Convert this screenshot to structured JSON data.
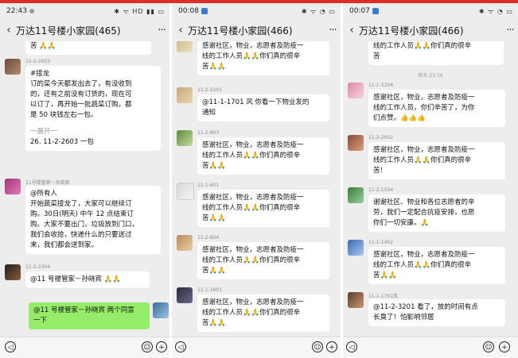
{
  "panels": [
    {
      "status_time": "22:43",
      "status_icons": "✱ ᯤ HD ▮▮ ▭",
      "title": "万达11号楼小家园(465)",
      "bell": "🔕",
      "more": "···",
      "messages": [
        {
          "sender": "",
          "lines": [
            "苦 🙏🙏"
          ]
        },
        {
          "sender": "11-2-2603",
          "lines": [
            "#接龙",
            "订的菜今天都发出去了，有没收到",
            "的，还有之前没有订货的，现在可",
            "以订了，再开始一批蔬菜订购，都",
            "是 50 块钱左右一包。",
            "",
            "一展开一",
            "26. 11-2-2603 一包"
          ]
        },
        {
          "sender": "11号楼管家－孙晓宾",
          "lines": [
            "@所有人",
            "开始蔬菜接龙了，大家可以继续订",
            "购。30日(明天) 中午 12 点结束订",
            "购。大家不要出门，垃圾放到门口，",
            "我们会收拾，快递什么的只要送过",
            "来，我们都会送到家。"
          ]
        },
        {
          "sender": "11-2-2304",
          "lines": [
            "@11 号楼管家－孙晓宾 🙏🙏"
          ]
        },
        {
          "sender": "",
          "lines": [
            "@11 号楼管家－孙晓宾  两个同意",
            "一下"
          ]
        }
      ]
    },
    {
      "status_time": "00:08",
      "status_icons": "✱ ᯤ ◔ ▭",
      "title": "万达11号楼小家园(466)",
      "bell": "🔕",
      "more": "···",
      "messages": [
        {
          "sender": "",
          "lines": [
            "感谢社区，物业，志愿者及防疫一",
            "线的工作人员🙏🙏你们真的很辛",
            "苦🙏🙏"
          ]
        },
        {
          "sender": "11-2-3201",
          "lines": [
            "@11-1-1701 风  你看一下物业发的",
            "通知"
          ]
        },
        {
          "sender": "11-2-803",
          "lines": [
            "感谢社区，物业，志愿者及防疫一",
            "线的工作人员🙏🙏你们真的很辛",
            "苦🙏🙏"
          ]
        },
        {
          "sender": "11-1-601",
          "lines": [
            "感谢社区，物业，志愿者及防疫一",
            "线的工作人员🙏🙏你们真的很辛",
            "苦🙏🙏"
          ]
        },
        {
          "sender": "11-2-804",
          "lines": [
            "感谢社区，物业，志愿者及防疫一",
            "线的工作人员🙏🙏你们真的很辛",
            "苦🙏🙏"
          ]
        },
        {
          "sender": "11-1-1601",
          "lines": [
            "感谢社区，物业，志愿者及防疫一",
            "线的工作人员🙏🙏你们真的很辛",
            "苦🙏🙏"
          ]
        }
      ]
    },
    {
      "status_time": "00:07",
      "status_icons": "✱ ᯤ ◔ ▭",
      "title": "万达11号楼小家园(466)",
      "bell": "🔕",
      "more": "···",
      "timestamp1": "昨天 23:16",
      "messages": [
        {
          "sender": "",
          "lines": [
            "线的工作人员🙏🙏你们真的很辛",
            "苦"
          ]
        },
        {
          "sender": "11-1-3204",
          "lines": [
            "感谢社区，物业，志愿者及防疫一",
            "线的工作人员，你们辛苦了，为你",
            "们点赞。👍👍👍"
          ]
        },
        {
          "sender": "11-3-2002",
          "lines": [
            "感谢社区，物业，志愿者及防疫一",
            "线的工作人员🙏🙏你们真的很辛",
            "苦！"
          ]
        },
        {
          "sender": "11-2-1504",
          "lines": [
            "谢谢社区、物业和各位志愿者的辛",
            "劳，我们一定配合抗疫安排，也愿",
            "你们一切安康。🙏"
          ]
        },
        {
          "sender": "11-1-1402",
          "lines": [
            "感谢社区，物业，志愿者及防疫一",
            "线的工作人员🙏🙏你们真的很辛",
            "苦🙏🙏"
          ]
        },
        {
          "sender": "11-1-1701风",
          "lines": [
            "@11-2-3201  看了，放的时间有点",
            "长臭了！怕影响邻居"
          ]
        }
      ]
    }
  ],
  "colors": {
    "red_bar": "#d9302c",
    "green_bubble": "#95ec69",
    "bg": "#ededed"
  },
  "icons": {
    "voice": "voice-icon",
    "emoji": "emoji-icon",
    "plus": "plus-icon"
  }
}
